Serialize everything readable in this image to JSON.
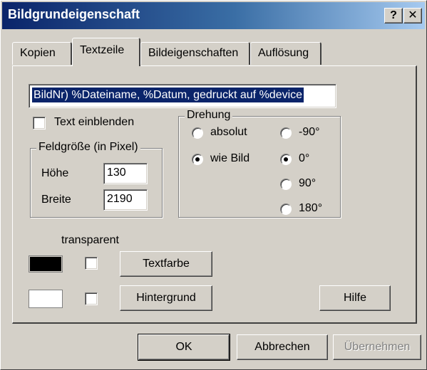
{
  "window": {
    "title": "Bildgrundeigenschaft",
    "help_button": "?",
    "close_button": "✕"
  },
  "tabs": [
    {
      "label": "Kopien"
    },
    {
      "label": "Textzeile"
    },
    {
      "label": "Bildeigenschaften"
    },
    {
      "label": "Auflösung"
    }
  ],
  "textline": {
    "value": "BildNr) %Dateiname, %Datum, gedruckt auf %device"
  },
  "show_text": {
    "label": "Text einblenden",
    "checked": false
  },
  "field_size": {
    "legend": "Feldgröße (in Pixel)",
    "height_label": "Höhe",
    "height_value": "130",
    "width_label": "Breite",
    "width_value": "2190"
  },
  "rotation": {
    "legend": "Drehung",
    "options": [
      {
        "label": "absolut",
        "checked": false
      },
      {
        "label": "wie Bild",
        "checked": true
      },
      {
        "label": "-90°",
        "checked": false
      },
      {
        "label": "0°",
        "checked": true
      },
      {
        "label": "90°",
        "checked": false
      },
      {
        "label": "180°",
        "checked": false
      }
    ]
  },
  "colors": {
    "transparent_label": "transparent",
    "text_color": "#000000",
    "background_color": "#ffffff",
    "text_transparent": false,
    "background_transparent": false,
    "textcolor_button": "Textfarbe",
    "background_button": "Hintergrund"
  },
  "buttons": {
    "help": "Hilfe",
    "ok": "OK",
    "cancel": "Abbrechen",
    "apply": "Übernehmen"
  }
}
